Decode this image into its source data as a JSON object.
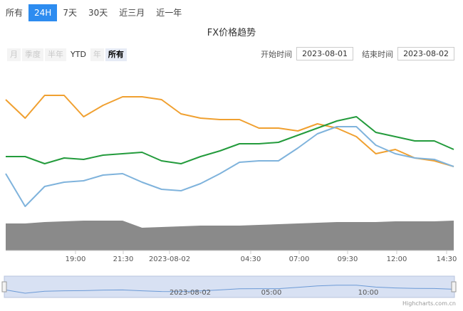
{
  "tabs": [
    {
      "label": "所有",
      "active": false
    },
    {
      "label": "24H",
      "active": true
    },
    {
      "label": "7天",
      "active": false
    },
    {
      "label": "30天",
      "active": false
    },
    {
      "label": "近三月",
      "active": false
    },
    {
      "label": "近一年",
      "active": false
    }
  ],
  "range_selector": {
    "buttons": [
      {
        "label": "月",
        "state": "disabled"
      },
      {
        "label": "季度",
        "state": "disabled"
      },
      {
        "label": "半年",
        "state": "disabled"
      },
      {
        "label": "YTD",
        "state": "enabled"
      },
      {
        "label": "年",
        "state": "disabled"
      },
      {
        "label": "所有",
        "state": "selected"
      }
    ],
    "start_label": "开始时间",
    "start_value": "2023-08-01",
    "end_label": "结束时间",
    "end_value": "2023-08-02"
  },
  "credit": "Highcharts.com.cn",
  "chart_data": {
    "type": "line",
    "title": "FX价格趋势",
    "x_ticks": [
      "19:00",
      "21:30",
      "2023-08-02",
      "04:30",
      "07:00",
      "09:30",
      "12:00",
      "14:30"
    ],
    "x": [
      "16:00",
      "17:00",
      "18:00",
      "19:00",
      "20:00",
      "21:00",
      "22:00",
      "23:00",
      "00:00",
      "01:00",
      "02:00",
      "03:00",
      "04:00",
      "05:00",
      "06:00",
      "07:00",
      "08:00",
      "09:00",
      "10:00",
      "11:00",
      "12:00",
      "13:00",
      "14:00",
      "15:00"
    ],
    "series": [
      {
        "color": "#f0a030",
        "values": [
          70,
          57,
          73,
          73,
          58,
          66,
          72,
          72,
          70,
          60,
          57,
          56,
          56,
          50,
          50,
          48,
          53,
          50,
          44,
          32,
          35,
          29,
          27,
          23
        ]
      },
      {
        "color": "#239b3c",
        "values": [
          30,
          30,
          25,
          29,
          28,
          31,
          32,
          33,
          27,
          25,
          30,
          34,
          39,
          39,
          40,
          45,
          50,
          55,
          58,
          47,
          44,
          41,
          41,
          35
        ]
      },
      {
        "color": "#7fb3dc",
        "values": [
          18,
          -5,
          9,
          12,
          13,
          17,
          18,
          12,
          7,
          6,
          11,
          18,
          26,
          27,
          27,
          36,
          46,
          51,
          51,
          38,
          32,
          29,
          28,
          23
        ]
      }
    ],
    "volume": [
      38,
      38,
      40,
      41,
      42,
      42,
      42,
      32,
      33,
      34,
      35,
      35,
      35,
      36,
      37,
      38,
      39,
      40,
      40,
      40,
      41,
      41,
      41,
      42
    ],
    "navigator": {
      "ticks": [
        "2023-08-02",
        "05:00",
        "10:00"
      ]
    }
  }
}
